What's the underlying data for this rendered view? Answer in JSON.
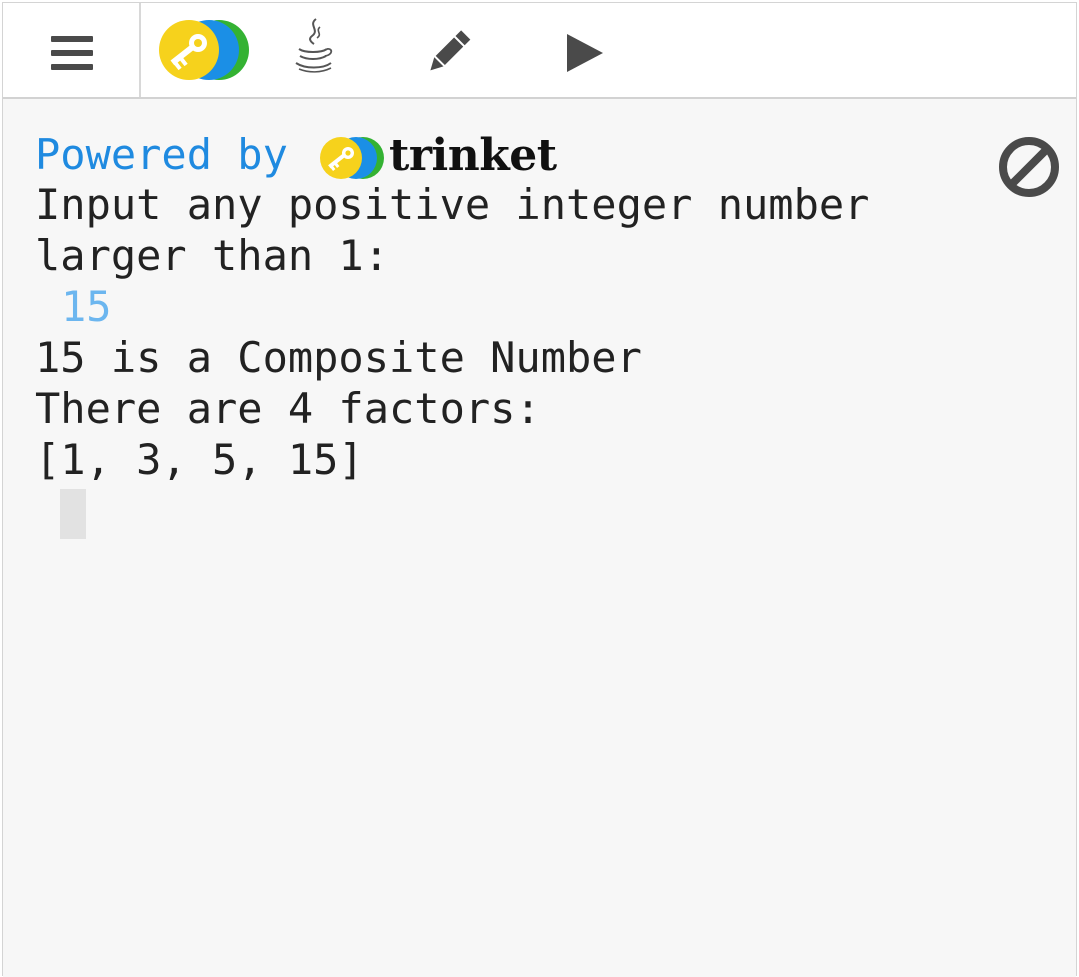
{
  "toolbar": {
    "menu_icon": "hamburger-menu-icon",
    "logo_icon": "trinket-key-logo-icon",
    "java_icon": "java-coffee-cup-icon",
    "edit_icon": "pencil-icon",
    "run_icon": "play-icon"
  },
  "console": {
    "powered_by": "Powered by",
    "brand": "trinket",
    "lines": [
      "Input any positive integer number",
      "larger than 1:",
      "15",
      "15 is a Composite Number",
      "There are 4 factors:",
      "[1, 3, 5, 15]"
    ],
    "stop_icon": "stop-prohibited-icon"
  },
  "colors": {
    "powered_blue": "#1f8ae0",
    "input_echo": "#6cb6ef",
    "logo_yellow": "#f6d21c",
    "logo_blue": "#1b8fe6",
    "logo_green": "#34b233",
    "icon_gray": "#4a4a4a"
  }
}
